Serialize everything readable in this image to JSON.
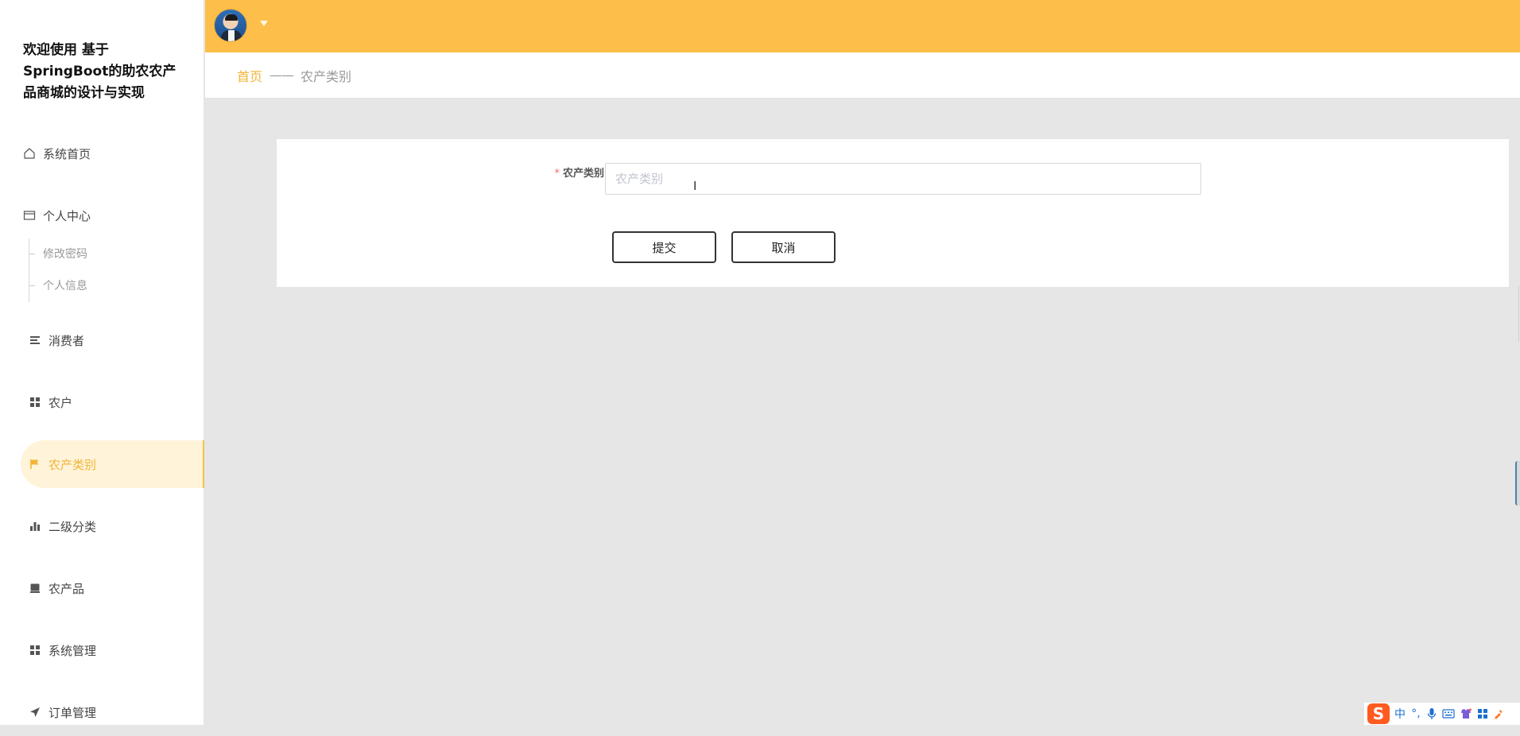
{
  "app": {
    "title": "欢迎使用 基于SpringBoot的助农农产品商城的设计与实现"
  },
  "sidebar": {
    "items": [
      {
        "label": "系统首页",
        "icon": "home-icon"
      },
      {
        "label": "个人中心",
        "icon": "id-card-icon"
      },
      {
        "label": "消费者",
        "icon": "list-icon"
      },
      {
        "label": "农户",
        "icon": "grid-icon"
      },
      {
        "label": "农产类别",
        "icon": "flag-icon",
        "active": true
      },
      {
        "label": "二级分类",
        "icon": "bar-chart-icon"
      },
      {
        "label": "农产品",
        "icon": "monitor-icon"
      },
      {
        "label": "系统管理",
        "icon": "grid-icon"
      },
      {
        "label": "订单管理",
        "icon": "send-icon"
      }
    ],
    "sub_items": [
      {
        "label": "修改密码"
      },
      {
        "label": "个人信息"
      }
    ]
  },
  "breadcrumb": {
    "home": "首页",
    "separator": "——",
    "current": "农产类别"
  },
  "form": {
    "field_label": "农产类别",
    "required_mark": "*",
    "field_value": "",
    "field_placeholder": "农产类别",
    "submit_label": "提交",
    "cancel_label": "取消"
  },
  "ime": {
    "logo": "S",
    "mode": "中",
    "punct": "°,",
    "icons": [
      "mic-icon",
      "keyboard-icon",
      "skin-icon",
      "apps-icon",
      "tools-icon"
    ]
  },
  "colors": {
    "accent": "#fdbf49",
    "active_text": "#f2b437",
    "active_bg": "#fff4d9",
    "required": "#f56c6c"
  }
}
